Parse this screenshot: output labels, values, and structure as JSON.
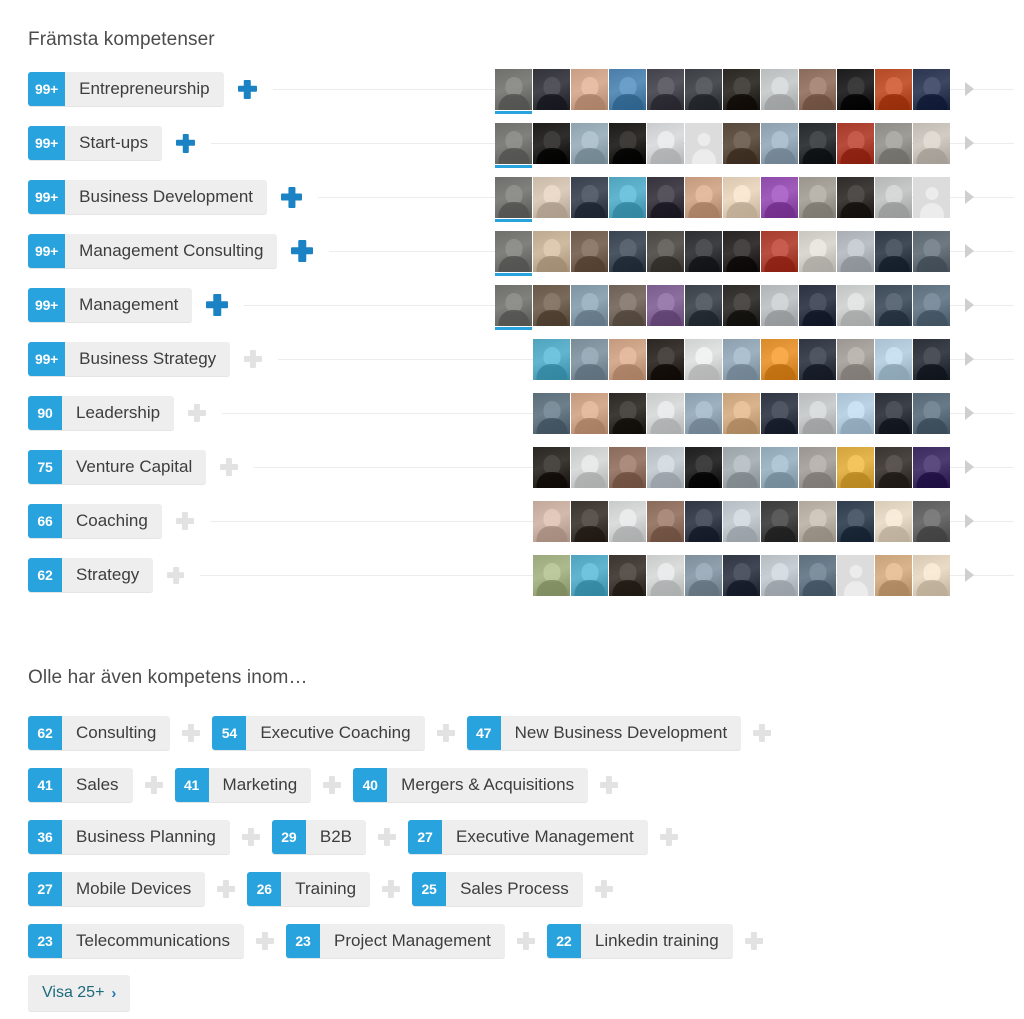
{
  "colors": {
    "badge_blue": "#29a3dd",
    "plus_blue": "#1b82c4",
    "plus_gray": "#e2e2e2",
    "pill_bg": "#eeeeee",
    "text": "#3d3d3d",
    "heading": "#4c4c4c",
    "link": "#1d6a7d"
  },
  "top_section": {
    "heading": "Främsta kompetenser",
    "skills": [
      {
        "count": "99+",
        "name": "Entrepreneurship",
        "plus_icon": "plus-icon",
        "plus_state": "blue",
        "endorser_count": 12,
        "has_active": true,
        "avatar_start": 495
      },
      {
        "count": "99+",
        "name": "Start-ups",
        "plus_icon": "plus-icon",
        "plus_state": "blue",
        "endorser_count": 12,
        "has_active": true,
        "avatar_start": 495
      },
      {
        "count": "99+",
        "name": "Business Development",
        "plus_icon": "plus-icon",
        "plus_state": "blue",
        "endorser_count": 12,
        "has_active": true,
        "avatar_start": 495
      },
      {
        "count": "99+",
        "name": "Management Consulting",
        "plus_icon": "plus-icon",
        "plus_state": "blue",
        "endorser_count": 12,
        "has_active": true,
        "avatar_start": 495
      },
      {
        "count": "99+",
        "name": "Management",
        "plus_icon": "plus-icon",
        "plus_state": "blue",
        "endorser_count": 12,
        "has_active": true,
        "avatar_start": 495
      },
      {
        "count": "99+",
        "name": "Business Strategy",
        "plus_icon": "plus-icon",
        "plus_state": "gray",
        "endorser_count": 11,
        "has_active": false,
        "avatar_start": 533
      },
      {
        "count": "90",
        "name": "Leadership",
        "plus_icon": "plus-icon",
        "plus_state": "gray",
        "endorser_count": 11,
        "has_active": false,
        "avatar_start": 533
      },
      {
        "count": "75",
        "name": "Venture Capital",
        "plus_icon": "plus-icon",
        "plus_state": "gray",
        "endorser_count": 11,
        "has_active": false,
        "avatar_start": 533
      },
      {
        "count": "66",
        "name": "Coaching",
        "plus_icon": "plus-icon",
        "plus_state": "gray",
        "endorser_count": 11,
        "has_active": false,
        "avatar_start": 533
      },
      {
        "count": "62",
        "name": "Strategy",
        "plus_icon": "plus-icon",
        "plus_state": "gray",
        "endorser_count": 11,
        "has_active": false,
        "avatar_start": 533
      }
    ],
    "next_icon": "chevron-right-icon"
  },
  "also_section": {
    "heading": "Olle har även kompetens inom…",
    "rows": [
      [
        {
          "count": "62",
          "name": "Consulting"
        },
        {
          "count": "54",
          "name": "Executive Coaching"
        },
        {
          "count": "47",
          "name": "New Business Development"
        }
      ],
      [
        {
          "count": "41",
          "name": "Sales"
        },
        {
          "count": "41",
          "name": "Marketing"
        },
        {
          "count": "40",
          "name": "Mergers & Acquisitions"
        }
      ],
      [
        {
          "count": "36",
          "name": "Business Planning"
        },
        {
          "count": "29",
          "name": "B2B"
        },
        {
          "count": "27",
          "name": "Executive Management"
        }
      ],
      [
        {
          "count": "27",
          "name": "Mobile Devices"
        },
        {
          "count": "26",
          "name": "Training"
        },
        {
          "count": "25",
          "name": "Sales Process"
        }
      ],
      [
        {
          "count": "23",
          "name": "Telecommunications"
        },
        {
          "count": "23",
          "name": "Project Management"
        },
        {
          "count": "22",
          "name": "Linkedin training"
        }
      ]
    ],
    "plus_icon": "plus-icon",
    "plus_state": "gray"
  },
  "show_more": {
    "label": "Visa 25+",
    "chevron": "›",
    "icon": "chevron-right-icon"
  },
  "avatar_palettes": [
    [
      "#6e6f6b",
      "#32323a",
      "#c79d84",
      "#4a7ea8",
      "#43424a",
      "#3b3f44",
      "#2a2622",
      "#b9bcbd",
      "#8a6b5b",
      "#1b1b1b",
      "#b34a26",
      "#2b3550"
    ],
    [
      "#6e6f6b",
      "#1d1c1a",
      "#8fa3ae",
      "#1d1b18",
      "#c9cbcc",
      "#dcdcdc",
      "#56473b",
      "#8c9fae",
      "#272a2c",
      "#a53a2a",
      "#8c8b86",
      "#c0bab2"
    ],
    [
      "#6e6f6b",
      "#c9b9a8",
      "#38404e",
      "#4fa3bd",
      "#35323c",
      "#c49a7e",
      "#d9c7b0",
      "#8e4aa8",
      "#99958c",
      "#2e2b28",
      "#b5b7b6",
      "#dcdcdc"
    ],
    [
      "#6e6f6b",
      "#bda890",
      "#6e5b4c",
      "#3a4450",
      "#4b4742",
      "#2d2e32",
      "#262322",
      "#a63c2e",
      "#c9c6c0",
      "#a8aeb3",
      "#2f3a46",
      "#5c6770"
    ],
    [
      "#6e6f6b",
      "#67584a",
      "#7f94a3",
      "#6d6157",
      "#7a5d8c",
      "#3b4149",
      "#2c2a27",
      "#b0b4b6",
      "#2b3140",
      "#c2c4c3",
      "#3d4a58",
      "#5d6e7d"
    ],
    [
      "#4fa3bd",
      "#7a8b98",
      "#c49a7e",
      "#2b2622",
      "#cfd1d0",
      "#8c9fae",
      "#d98a2b",
      "#2f3540",
      "#9b9691",
      "#a8c0d0",
      "#2b3038"
    ],
    [
      "#5c6d7a",
      "#c49a7e",
      "#2c2824",
      "#c8cbca",
      "#8c9fae",
      "#c7a27a",
      "#2f3542",
      "#b9bcbd",
      "#a9c1d2",
      "#2b3038",
      "#566775"
    ],
    [
      "#2a2622",
      "#c7c9c8",
      "#8a6b5b",
      "#b5bcc2",
      "#1e1e1e",
      "#9aa3a8",
      "#8fa6b5",
      "#9a9590",
      "#d3a33c",
      "#3a3430",
      "#3a2a5e"
    ],
    [
      "#c2a89a",
      "#3b342e",
      "#c8cbca",
      "#8a6b5b",
      "#2f3542",
      "#b5bcc2",
      "#3a3a3a",
      "#b0a79c",
      "#2f3d4c",
      "#d8cbb8",
      "#5c5c5c"
    ],
    [
      "#9aa87c",
      "#4fa3bd",
      "#3b342e",
      "#c8cbca",
      "#7e8e9b",
      "#2f3542",
      "#b5bcc2",
      "#5d6e7d",
      "#dcdcdc",
      "#c7a27a",
      "#d8c9b4"
    ]
  ]
}
